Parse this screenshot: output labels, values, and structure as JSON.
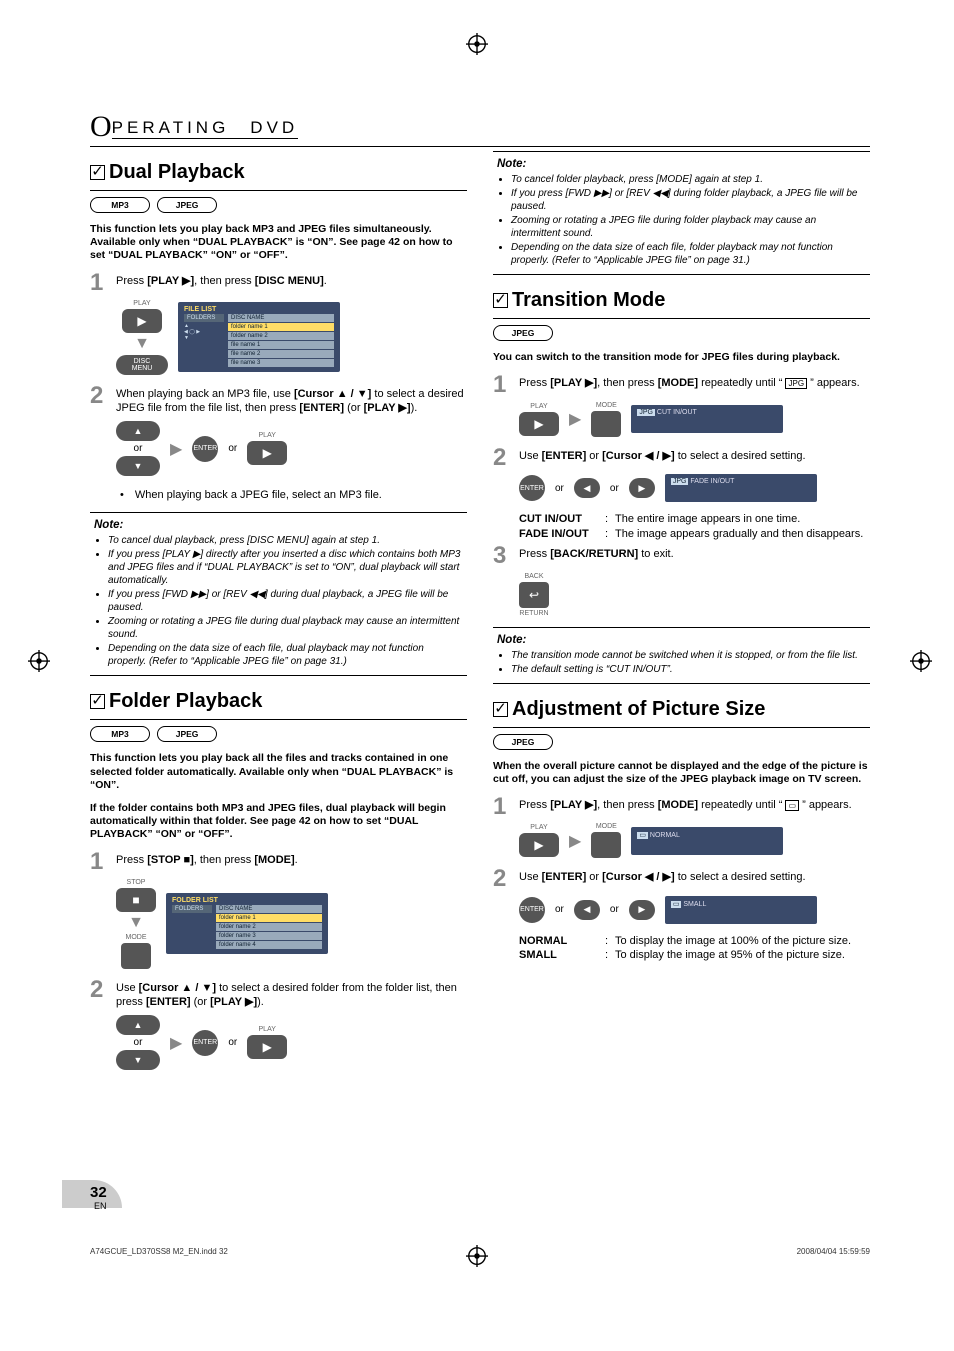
{
  "chapter": {
    "big": "O",
    "rest": "PERATING　DVD"
  },
  "registration_glyph": "⊕",
  "formats": {
    "mp3": "MP3",
    "jpeg": "JPEG"
  },
  "dual": {
    "title": "Dual Playback",
    "intro": "This function lets you play back MP3 and JPEG files simultaneously. Available only when “DUAL PLAYBACK” is “ON”. See page 42 on how to set “DUAL PLAYBACK” “ON” or “OFF”.",
    "step1": "Press [PLAY ▶], then press [DISC MENU].",
    "step2": "When playing back an MP3 file, use [Cursor ▲ / ▼] to select a desired JPEG file from the file list, then press [ENTER] (or [PLAY ▶]).",
    "sub": "When playing back a JPEG file, select an MP3 file.",
    "notes": [
      "To cancel dual playback, press [DISC MENU] again at step 1.",
      "If you press [PLAY ▶] directly after you inserted a disc which contains both MP3 and JPEG files and if “DUAL PLAYBACK” is set to “ON”, dual playback will start automatically.",
      "If you press [FWD ▶▶] or [REV ◀◀] during dual playback, a JPEG file will be paused.",
      "Zooming or rotating a JPEG file during dual playback may cause an intermittent sound.",
      "Depending on the data size of each file, dual playback may not function properly. (Refer to “Applicable JPEG file” on page 31.)"
    ]
  },
  "folder": {
    "title": "Folder Playback",
    "intro1": "This function lets you play back all the files and tracks contained in one selected folder automatically. Available only when “DUAL PLAYBACK” is “ON”.",
    "intro2": "If the folder contains both MP3 and JPEG files, dual playback will begin automatically within that folder. See page 42 on how to set “DUAL PLAYBACK” “ON” or “OFF”.",
    "step1": "Press [STOP ■], then press [MODE].",
    "step2": "Use [Cursor ▲ / ▼] to select a desired folder from the folder list, then press [ENTER] (or [PLAY ▶])."
  },
  "folder_notes": [
    "To cancel folder playback, press [MODE] again at step 1.",
    "If you press [FWD ▶▶] or [REV ◀◀] during folder playback, a JPEG file will be paused.",
    "Zooming or rotating a JPEG file during folder playback may cause an intermittent sound.",
    "Depending on the data size of each file, folder playback may not function properly. (Refer to “Applicable JPEG file” on page 31.)"
  ],
  "transition": {
    "title": "Transition Mode",
    "intro": "You can switch to the transition mode for JPEG files during playback.",
    "step1": "Press [PLAY ▶], then press [MODE] repeatedly until “ ▭ ” appears.",
    "step2": "Use [ENTER] or [Cursor ◀ / ▶] to select a desired setting.",
    "step3": "Press [BACK/RETURN] to exit.",
    "def_cut": "The entire image appears in one time.",
    "def_fade": "The image appears gradually and then disappears.",
    "osd1": "CUT IN/OUT",
    "osd2": "FADE IN/OUT",
    "notes": [
      "The transition mode cannot be switched when it is stopped, or from the file list.",
      "The default setting is “CUT IN/OUT”."
    ]
  },
  "adjust": {
    "title": "Adjustment of Picture Size",
    "intro": "When the overall picture cannot be displayed and the edge of the picture is cut off, you can adjust the size of the JPEG playback image on TV screen.",
    "step1": "Press [PLAY ▶], then press [MODE] repeatedly until “ ▭ ” appears.",
    "step2": "Use [ENTER] or [Cursor ◀ / ▶] to select a desired setting.",
    "def_normal": "To display the image at 100% of the picture size.",
    "def_small": "To display the image at 95% of the picture size.",
    "osd1": "NORMAL",
    "osd2": "SMALL"
  },
  "labels": {
    "play": "PLAY",
    "disc_menu": "DISC\nMENU",
    "enter": "ENTER",
    "or": "or",
    "stop": "STOP",
    "mode": "MODE",
    "back": "BACK",
    "return": "RETURN",
    "note": "Note:",
    "cut": "CUT IN/OUT",
    "fade": "FADE IN/OUT",
    "normal": "NORMAL",
    "small": "SMALL",
    "osd_filelist": "FILE LIST",
    "osd_folderlist": "FOLDER LIST",
    "osd_discname": "DISC NAME",
    "osd_folders": "FOLDERS"
  },
  "page": {
    "num": "32",
    "lang": "EN"
  },
  "printline": {
    "left": "A74GCUE_LD370SS8 M2_EN.indd   32",
    "right": "2008/04/04   15:59:59"
  }
}
